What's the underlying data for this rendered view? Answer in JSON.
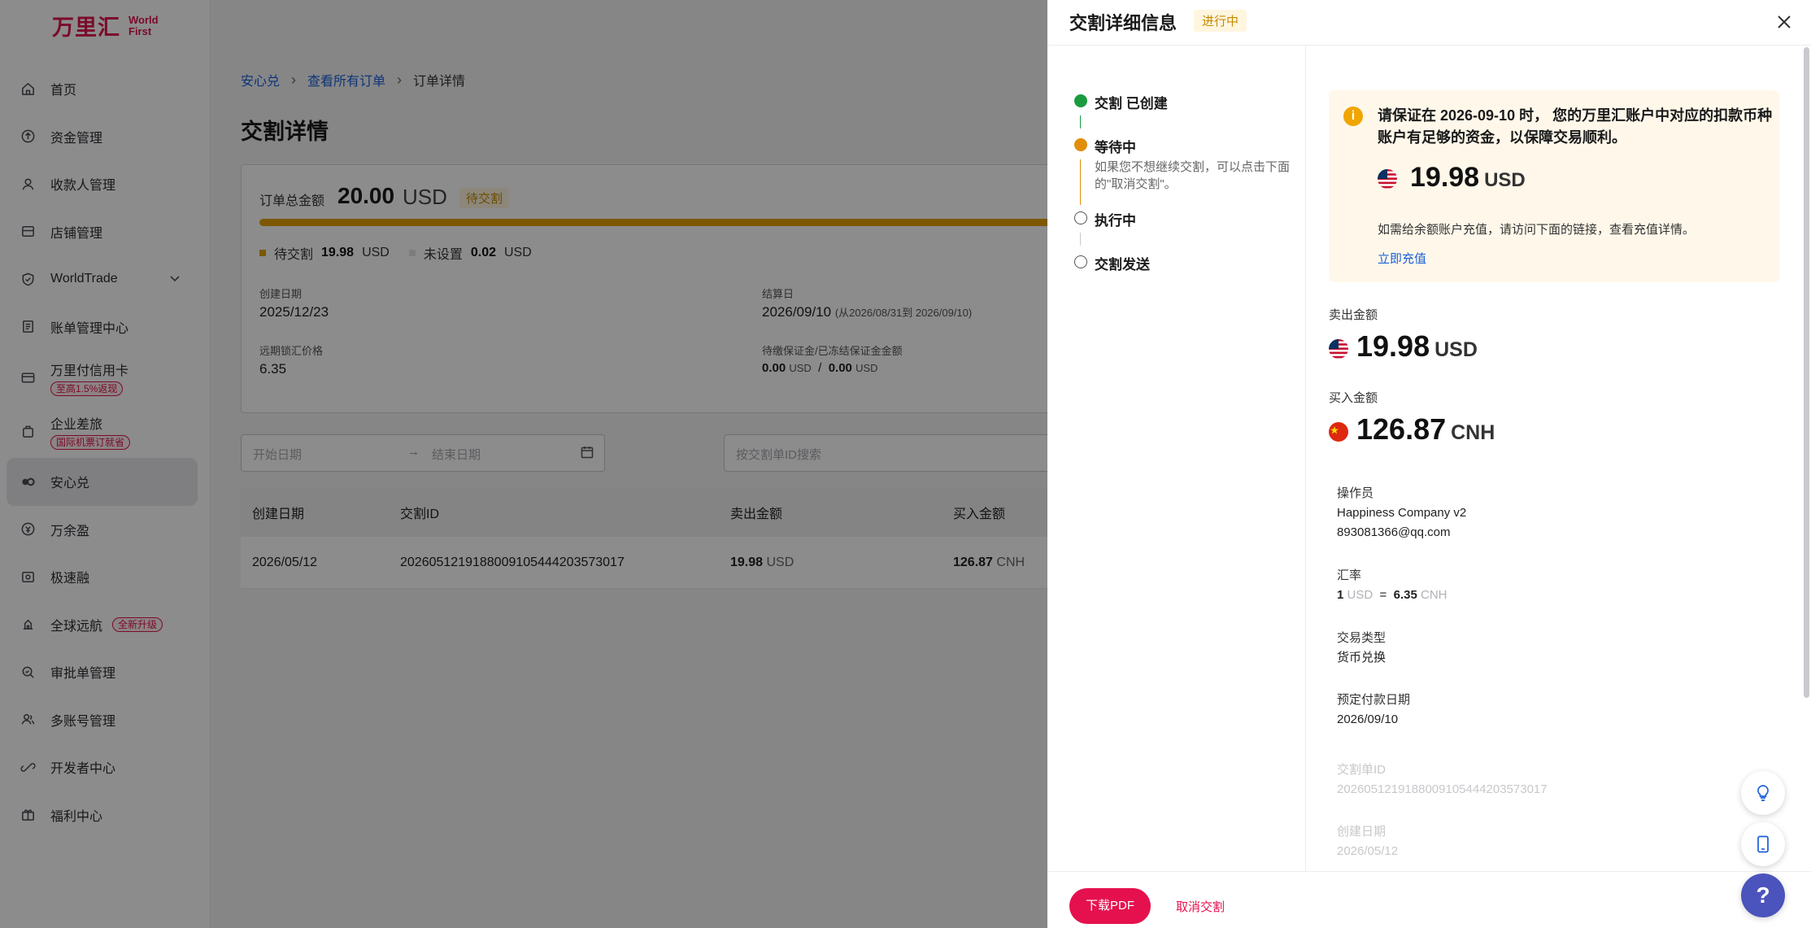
{
  "brand": {
    "cn": "万里汇",
    "en_line1": "World",
    "en_line2": "First",
    "color": "#e0144e"
  },
  "sidebar": {
    "items": [
      {
        "label": "首页",
        "icon": "home-icon"
      },
      {
        "label": "资金管理",
        "icon": "fund-icon"
      },
      {
        "label": "收款人管理",
        "icon": "payee-icon"
      },
      {
        "label": "店铺管理",
        "icon": "store-icon"
      },
      {
        "label": "WorldTrade",
        "icon": "shield-icon"
      },
      {
        "label": "账单管理中心",
        "icon": "bill-icon"
      },
      {
        "label": "万里付信用卡",
        "icon": "card-icon",
        "tag": "至高1.5%返现"
      },
      {
        "label": "企业差旅",
        "icon": "travel-icon",
        "tag": "国际机票订就省"
      },
      {
        "label": "安心兑",
        "icon": "exchange-icon",
        "active": true
      },
      {
        "label": "万余盈",
        "icon": "yield-icon"
      },
      {
        "label": "极速融",
        "icon": "finance-icon"
      },
      {
        "label": "全球远航",
        "icon": "global-icon",
        "tag": "全新升级"
      },
      {
        "label": "审批单管理",
        "icon": "approval-icon"
      },
      {
        "label": "多账号管理",
        "icon": "accounts-icon"
      },
      {
        "label": "开发者中心",
        "icon": "developer-icon"
      },
      {
        "label": "福利中心",
        "icon": "gift-icon"
      }
    ]
  },
  "main": {
    "breadcrumb": [
      "安心兑",
      "查看所有订单",
      "订单详情"
    ],
    "title": "交割详情",
    "order": {
      "total_label": "订单总金额",
      "total_value": "20.00",
      "total_ccy": "USD",
      "status": "待交割",
      "legend": [
        {
          "label": "待交割",
          "value": "19.98",
          "ccy": "USD",
          "color": "#e4a000"
        },
        {
          "label": "未设置",
          "value": "0.02",
          "ccy": "USD",
          "color": "#e3e3e8"
        }
      ],
      "created_label": "创建日期",
      "created_value": "2025/12/23",
      "settle_label": "结算日",
      "settle_value": "2026/09/10",
      "settle_range": "(从2026/08/31到 2026/09/10)",
      "rate_label": "远期锁汇价格",
      "rate_value": "6.35",
      "margin_label": "待缴保证金/已冻结保证金金额",
      "margin_a": "0.00",
      "margin_a_ccy": "USD",
      "margin_sep": "/",
      "margin_b": "0.00",
      "margin_b_ccy": "USD"
    },
    "filters": {
      "start_placeholder": "开始日期",
      "arrow": "→",
      "end_placeholder": "结束日期",
      "search_placeholder": "按交割单ID搜索"
    },
    "table": {
      "headers": [
        "创建日期",
        "交割ID",
        "卖出金额",
        "买入金额"
      ],
      "rows": [
        {
          "date": "2026/05/12",
          "id": "20260512191880091054442035730​17",
          "sell": "19.98",
          "sell_ccy": "USD",
          "buy": "126.87",
          "buy_ccy": "CNH"
        }
      ]
    }
  },
  "drawer": {
    "title": "交割详细信息",
    "badge": "进行中",
    "steps": [
      {
        "label": "交割 已创建",
        "state": "done",
        "color": "#1a9c3e"
      },
      {
        "label": "等待中",
        "state": "current",
        "color": "#e08e0b",
        "desc": "如果您不想继续交割，可以点击下面的\"取消交割\"。"
      },
      {
        "label": "执行中",
        "state": "pending"
      },
      {
        "label": "交割发送",
        "state": "pending"
      }
    ],
    "notice": {
      "message": "请保证在 2026-09-10 时， 您的万里汇账户中对应的扣款币种账户有足够的资金，以保障交易顺利。",
      "amount": "19.98",
      "ccy": "USD",
      "hint": "如需给余额账户充值，请访问下面的链接，查看充值详情。",
      "link": "立即充值"
    },
    "sell": {
      "label": "卖出金额",
      "amount": "19.98",
      "ccy": "USD"
    },
    "buy": {
      "label": "买入金额",
      "amount": "126.87",
      "ccy": "CNH"
    },
    "operator": {
      "label": "操作员",
      "name": "Happiness Company v2",
      "email": "893081366@qq.com"
    },
    "rate": {
      "label": "汇率",
      "left": "1",
      "left_ccy": "USD",
      "eq": "=",
      "right": "6.35",
      "right_ccy": "CNH"
    },
    "trade_type": {
      "label": "交易类型",
      "value": "货币兑换"
    },
    "pay_date": {
      "label": "预定付款日期",
      "value": "2026/09/10"
    },
    "delivery_id": {
      "label": "交割单ID",
      "value": "20260512191880091054442035730​17"
    },
    "created": {
      "label": "创建日期",
      "value": "2026/05/12"
    },
    "footer": {
      "pdf": "下载PDF",
      "cancel": "取消交割"
    },
    "fabs": {
      "help": "?"
    }
  }
}
